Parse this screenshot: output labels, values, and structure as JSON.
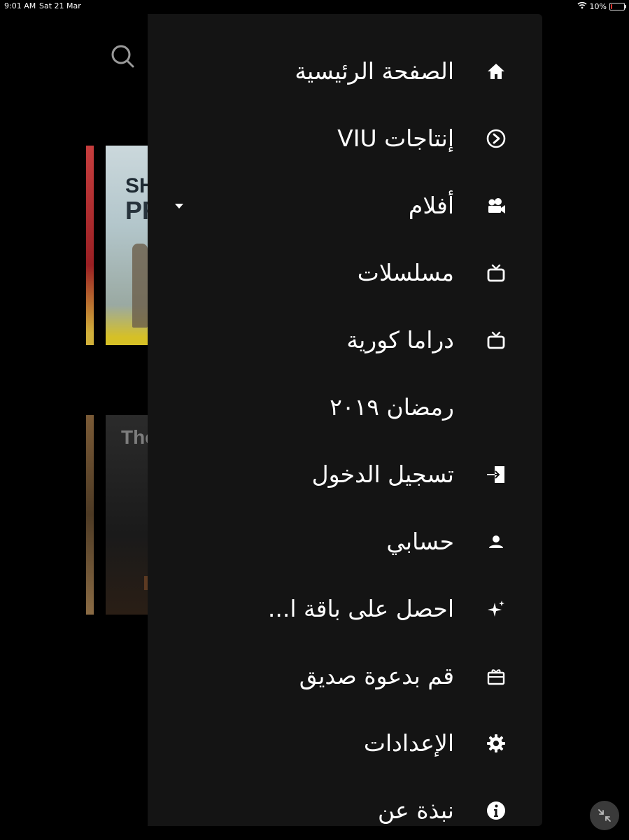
{
  "status_bar": {
    "time": "9:01 AM",
    "date": "Sat 21 Mar",
    "battery": "10%",
    "battery_level": 0.1,
    "battery_color": "#e3342f"
  },
  "background": {
    "search_icon": "search-icon",
    "posters": [
      {
        "text_line1": "SH",
        "text_line2": "PR"
      },
      {
        "text_line1": "The"
      }
    ]
  },
  "menu": {
    "background_color": "#141414",
    "items": [
      {
        "label": "الصفحة الرئيسية",
        "icon": "home-icon"
      },
      {
        "label": "إنتاجات VIU",
        "icon": "viu-play-icon"
      },
      {
        "label": "أفلام",
        "icon": "movie-camera-icon",
        "has_dropdown": true
      },
      {
        "label": "مسلسلات",
        "icon": "tv-icon"
      },
      {
        "label": "دراما كورية",
        "icon": "tv-icon"
      },
      {
        "label": "رمضان ٢٠١٩",
        "icon": ""
      },
      {
        "label": "تسجيل الدخول",
        "icon": "sign-in-icon"
      },
      {
        "label": "حسابي",
        "icon": "person-icon"
      },
      {
        "label": "احصل على باقة ا...",
        "icon": "sparkle-icon"
      },
      {
        "label": "قم بدعوة صديق",
        "icon": "gift-icon"
      },
      {
        "label": "الإعدادات",
        "icon": "gear-icon"
      },
      {
        "label": "نبذة عن",
        "icon": "info-icon"
      }
    ]
  },
  "floating_button": {
    "icon": "collapse-arrows-icon"
  }
}
